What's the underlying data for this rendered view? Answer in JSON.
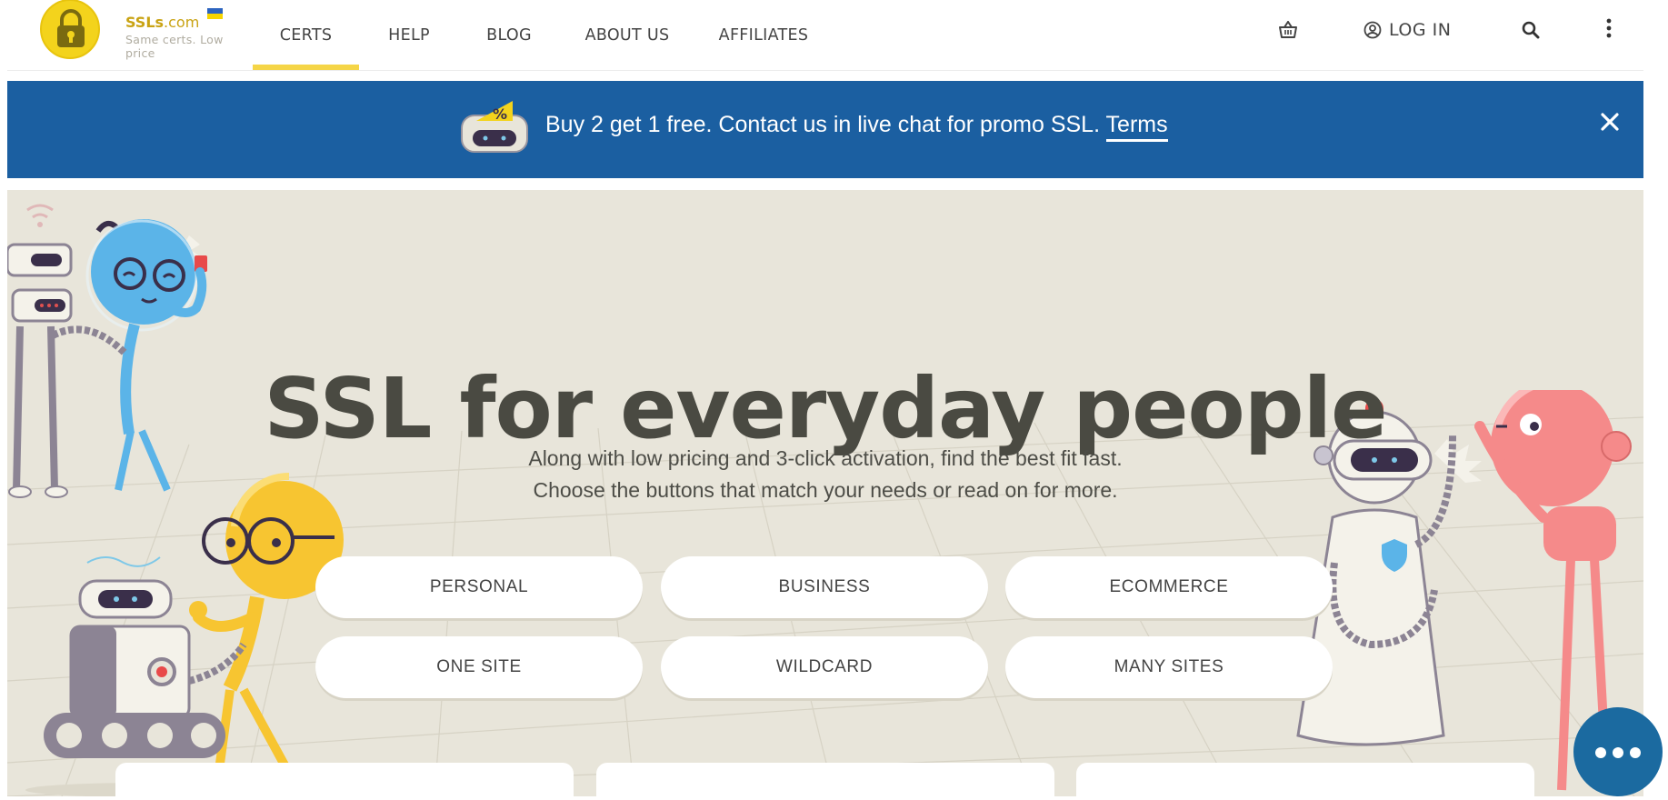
{
  "header": {
    "logo": {
      "name": "SSLs",
      "domain_suffix": ".com",
      "tagline": "Same certs. Low price"
    },
    "nav": [
      {
        "label": "CERTS",
        "active": true
      },
      {
        "label": "HELP",
        "active": false
      },
      {
        "label": "BLOG",
        "active": false
      },
      {
        "label": "ABOUT US",
        "active": false
      },
      {
        "label": "AFFILIATES",
        "active": false
      }
    ],
    "login_label": "LOG IN",
    "icons": [
      "cart-icon",
      "user-icon",
      "search-icon",
      "more-vertical-icon"
    ]
  },
  "promo": {
    "text": "Buy 2 get 1 free. Contact us in live chat for promo SSL.",
    "link_label": "Terms",
    "close_icon": "close-icon"
  },
  "hero": {
    "title": "SSL for everyday people",
    "subtitle_line1": "Along with low pricing and 3-click activation, find the best fit fast.",
    "subtitle_line2": "Choose the buttons that match your needs or read on for more.",
    "buttons": [
      "PERSONAL",
      "BUSINESS",
      "ECOMMERCE",
      "ONE SITE",
      "WILDCARD",
      "MANY SITES"
    ]
  },
  "colors": {
    "accent_yellow": "#f5d547",
    "promo_blue": "#1b5fa1",
    "hero_bg": "#e8e5da",
    "chat_blue": "#1b6aa0"
  },
  "chat": {
    "icon": "chat-bubble-icon"
  }
}
